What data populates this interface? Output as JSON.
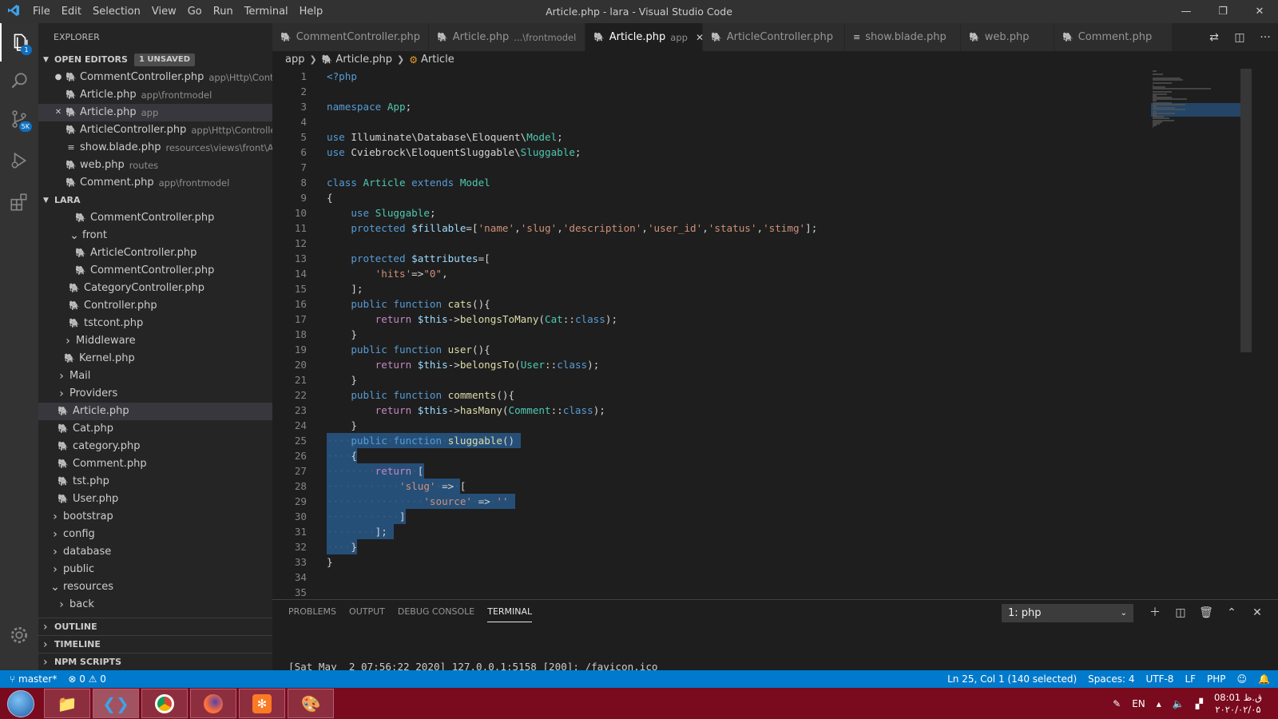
{
  "window": {
    "title": "Article.php - lara - Visual Studio Code"
  },
  "menu": [
    "File",
    "Edit",
    "Selection",
    "View",
    "Go",
    "Run",
    "Terminal",
    "Help"
  ],
  "activity": {
    "explorer_badge": "1",
    "scm_badge": "5K"
  },
  "sidebar": {
    "title": "EXPLORER",
    "open_editors": {
      "label": "OPEN EDITORS",
      "count": "1 UNSAVED"
    },
    "open_files": [
      {
        "name": "CommentController.php",
        "desc": "app\\Http\\Contr...",
        "marker": "●"
      },
      {
        "name": "Article.php",
        "desc": "app\\frontmodel",
        "marker": ""
      },
      {
        "name": "Article.php",
        "desc": "app",
        "marker": "✕"
      },
      {
        "name": "ArticleController.php",
        "desc": "app\\Http\\Controller...",
        "marker": ""
      },
      {
        "name": "show.blade.php",
        "desc": "resources\\views\\front\\Art...",
        "marker": ""
      },
      {
        "name": "web.php",
        "desc": "routes",
        "marker": ""
      },
      {
        "name": "Comment.php",
        "desc": "app\\frontmodel",
        "marker": ""
      }
    ],
    "project": {
      "label": "LARA"
    },
    "tree": [
      {
        "name": "CommentController.php",
        "type": "file"
      },
      {
        "name": "front",
        "type": "folder-open"
      },
      {
        "name": "ArticleController.php",
        "type": "file"
      },
      {
        "name": "CommentController.php",
        "type": "file"
      },
      {
        "name": "CategoryController.php",
        "type": "file"
      },
      {
        "name": "Controller.php",
        "type": "file"
      },
      {
        "name": "tstcont.php",
        "type": "file"
      },
      {
        "name": "Middleware",
        "type": "folder"
      },
      {
        "name": "Kernel.php",
        "type": "file"
      },
      {
        "name": "Mail",
        "type": "folder"
      },
      {
        "name": "Providers",
        "type": "folder"
      },
      {
        "name": "Article.php",
        "type": "file"
      },
      {
        "name": "Cat.php",
        "type": "file"
      },
      {
        "name": "category.php",
        "type": "file"
      },
      {
        "name": "Comment.php",
        "type": "file"
      },
      {
        "name": "tst.php",
        "type": "file"
      },
      {
        "name": "User.php",
        "type": "file"
      },
      {
        "name": "bootstrap",
        "type": "folder"
      },
      {
        "name": "config",
        "type": "folder"
      },
      {
        "name": "database",
        "type": "folder"
      },
      {
        "name": "public",
        "type": "folder"
      },
      {
        "name": "resources",
        "type": "folder-open"
      },
      {
        "name": "back",
        "type": "folder"
      }
    ],
    "bottom_sections": [
      "OUTLINE",
      "TIMELINE",
      "NPM SCRIPTS"
    ]
  },
  "tabs": [
    {
      "label": "CommentController.php",
      "desc": "",
      "state": "dirty"
    },
    {
      "label": "Article.php",
      "desc": "...\\frontmodel",
      "state": ""
    },
    {
      "label": "Article.php",
      "desc": "app",
      "state": "active"
    },
    {
      "label": "ArticleController.php",
      "desc": "",
      "state": ""
    },
    {
      "label": "show.blade.php",
      "desc": "",
      "state": ""
    },
    {
      "label": "web.php",
      "desc": "",
      "state": ""
    },
    {
      "label": "Comment.php",
      "desc": "",
      "state": ""
    }
  ],
  "breadcrumb": {
    "folder": "app",
    "file": "Article.php",
    "symbol": "Article"
  },
  "code_lines": [
    [
      [
        "kw",
        "<?php"
      ]
    ],
    [],
    [
      [
        "kw",
        "namespace "
      ],
      [
        "ty",
        "App"
      ],
      [
        "pu",
        ";"
      ]
    ],
    [],
    [
      [
        "kw",
        "use "
      ],
      [
        "pu",
        "Illuminate\\Database\\Eloquent\\"
      ],
      [
        "ty",
        "Model"
      ],
      [
        "pu",
        ";"
      ]
    ],
    [
      [
        "kw",
        "use "
      ],
      [
        "pu",
        "Cviebrock\\EloquentSluggable\\"
      ],
      [
        "ty",
        "Sluggable"
      ],
      [
        "pu",
        ";"
      ]
    ],
    [],
    [
      [
        "kw",
        "class "
      ],
      [
        "ty",
        "Article "
      ],
      [
        "kw",
        "extends "
      ],
      [
        "ty",
        "Model"
      ]
    ],
    [
      [
        "pu",
        "{"
      ]
    ],
    [
      [
        "pu",
        "    "
      ],
      [
        "kw",
        "use "
      ],
      [
        "ty",
        "Sluggable"
      ],
      [
        "pu",
        ";"
      ]
    ],
    [
      [
        "pu",
        "    "
      ],
      [
        "kw",
        "protected "
      ],
      [
        "vr",
        "$fillable"
      ],
      [
        "pu",
        "=["
      ],
      [
        "st",
        "'name'"
      ],
      [
        "pu",
        ","
      ],
      [
        "st",
        "'slug'"
      ],
      [
        "pu",
        ","
      ],
      [
        "st",
        "'description'"
      ],
      [
        "pu",
        ","
      ],
      [
        "st",
        "'user_id'"
      ],
      [
        "pu",
        ","
      ],
      [
        "st",
        "'status'"
      ],
      [
        "pu",
        ","
      ],
      [
        "st",
        "'stimg'"
      ],
      [
        "pu",
        "];"
      ]
    ],
    [],
    [
      [
        "pu",
        "    "
      ],
      [
        "kw",
        "protected "
      ],
      [
        "vr",
        "$attributes"
      ],
      [
        "pu",
        "=["
      ]
    ],
    [
      [
        "pu",
        "        "
      ],
      [
        "st",
        "'hits'"
      ],
      [
        "pu",
        "=>"
      ],
      [
        "st",
        "\"0\""
      ],
      [
        "pu",
        ","
      ]
    ],
    [
      [
        "pu",
        "    ];"
      ]
    ],
    [
      [
        "pu",
        "    "
      ],
      [
        "kw",
        "public "
      ],
      [
        "kw",
        "function "
      ],
      [
        "fn",
        "cats"
      ],
      [
        "pu",
        "(){"
      ]
    ],
    [
      [
        "pu",
        "        "
      ],
      [
        "ctl",
        "return "
      ],
      [
        "vr",
        "$this"
      ],
      [
        "pu",
        "->"
      ],
      [
        "fn",
        "belongsToMany"
      ],
      [
        "pu",
        "("
      ],
      [
        "ty",
        "Cat"
      ],
      [
        "pu",
        "::"
      ],
      [
        "kw",
        "class"
      ],
      [
        "pu",
        ");"
      ]
    ],
    [
      [
        "pu",
        "    }"
      ]
    ],
    [
      [
        "pu",
        "    "
      ],
      [
        "kw",
        "public "
      ],
      [
        "kw",
        "function "
      ],
      [
        "fn",
        "user"
      ],
      [
        "pu",
        "(){"
      ]
    ],
    [
      [
        "pu",
        "        "
      ],
      [
        "ctl",
        "return "
      ],
      [
        "vr",
        "$this"
      ],
      [
        "pu",
        "->"
      ],
      [
        "fn",
        "belongsTo"
      ],
      [
        "pu",
        "("
      ],
      [
        "ty",
        "User"
      ],
      [
        "pu",
        "::"
      ],
      [
        "kw",
        "class"
      ],
      [
        "pu",
        ");"
      ]
    ],
    [
      [
        "pu",
        "    }"
      ]
    ],
    [
      [
        "pu",
        "    "
      ],
      [
        "kw",
        "public "
      ],
      [
        "kw",
        "function "
      ],
      [
        "fn",
        "comments"
      ],
      [
        "pu",
        "(){"
      ]
    ],
    [
      [
        "pu",
        "        "
      ],
      [
        "ctl",
        "return "
      ],
      [
        "vr",
        "$this"
      ],
      [
        "pu",
        "->"
      ],
      [
        "fn",
        "hasMany"
      ],
      [
        "pu",
        "("
      ],
      [
        "ty",
        "Comment"
      ],
      [
        "pu",
        "::"
      ],
      [
        "kw",
        "class"
      ],
      [
        "pu",
        ");"
      ]
    ],
    [
      [
        "pu",
        "    }"
      ]
    ],
    [
      [
        "ws",
        "····"
      ],
      [
        "kw",
        "public"
      ],
      [
        "ws",
        "·"
      ],
      [
        "kw",
        "function"
      ],
      [
        "ws",
        "·"
      ],
      [
        "fn",
        "sluggable"
      ],
      [
        "pu",
        "()"
      ]
    ],
    [
      [
        "ws",
        "····"
      ],
      [
        "pu",
        "{"
      ]
    ],
    [
      [
        "ws",
        "········"
      ],
      [
        "ctl",
        "return"
      ],
      [
        "ws",
        "·"
      ],
      [
        "pu",
        "["
      ]
    ],
    [
      [
        "ws",
        "············"
      ],
      [
        "st",
        "'slug'"
      ],
      [
        "ws",
        "·"
      ],
      [
        "pu",
        "=>"
      ],
      [
        "ws",
        "·"
      ],
      [
        "pu",
        "["
      ]
    ],
    [
      [
        "ws",
        "················"
      ],
      [
        "st",
        "'source'"
      ],
      [
        "ws",
        "·"
      ],
      [
        "pu",
        "=>"
      ],
      [
        "ws",
        "·"
      ],
      [
        "st",
        "''"
      ]
    ],
    [
      [
        "ws",
        "············"
      ],
      [
        "pu",
        "]"
      ]
    ],
    [
      [
        "ws",
        "········"
      ],
      [
        "pu",
        "];"
      ]
    ],
    [
      [
        "ws",
        "····"
      ],
      [
        "pu",
        "}"
      ]
    ],
    [
      [
        "pu",
        "}"
      ]
    ],
    [],
    []
  ],
  "selection_widths": [
    32,
    5,
    16,
    22,
    31,
    13,
    11,
    5,
    0,
    0
  ],
  "panel": {
    "tabs": [
      "PROBLEMS",
      "OUTPUT",
      "DEBUG CONSOLE",
      "TERMINAL"
    ],
    "active_tab": "TERMINAL",
    "terminal_select": "1: php",
    "terminal_line": "[Sat May  2 07:56:22 2020] 127.0.0.1:5158 [200]: /favicon.ico"
  },
  "statusbar": {
    "branch": "master*",
    "problems": "⊗ 0 ⚠ 0",
    "position": "Ln 25, Col 1 (140 selected)",
    "spaces": "Spaces: 4",
    "encoding": "UTF-8",
    "eol": "LF",
    "language": "PHP"
  },
  "taskbar": {
    "apps": [
      "file-explorer-icon",
      "vscode-icon",
      "chrome-icon",
      "firefox-icon",
      "xampp-icon",
      "paint-icon"
    ],
    "lang": "EN",
    "time": "08:01 ق.ظ",
    "date": "۲۰۲۰/۰۲/۰۵"
  },
  "colors": {
    "accent": "#007acc",
    "selection": "#264f78",
    "taskbar": "#7a0a1e"
  }
}
